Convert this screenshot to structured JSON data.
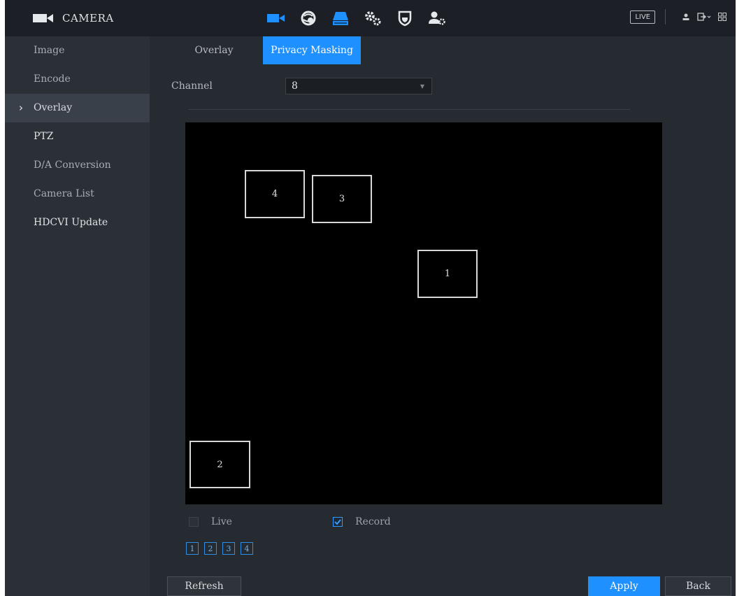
{
  "app": {
    "title": "CAMERA",
    "icon": "camera-icon"
  },
  "nav_icons": [
    {
      "name": "camera-nav-icon",
      "color": "#1e90ff"
    },
    {
      "name": "network-nav-icon",
      "color": "#e6e6e6"
    },
    {
      "name": "storage-nav-icon",
      "color": "#1e90ff"
    },
    {
      "name": "system-settings-nav-icon",
      "color": "#e6e6e6"
    },
    {
      "name": "security-nav-icon",
      "color": "#e6e6e6"
    },
    {
      "name": "account-nav-icon",
      "color": "#e6e6e6"
    }
  ],
  "header_tools": {
    "live_label": "LIVE"
  },
  "sidebar": {
    "items": [
      {
        "label": "Image"
      },
      {
        "label": "Encode"
      },
      {
        "label": "Overlay",
        "active": true
      },
      {
        "label": "PTZ"
      },
      {
        "label": "D/A Conversion"
      },
      {
        "label": "Camera List"
      },
      {
        "label": "HDCVI Update"
      }
    ]
  },
  "tabs": [
    {
      "label": "Overlay"
    },
    {
      "label": "Privacy Masking",
      "selected": true
    }
  ],
  "channel": {
    "label": "Channel",
    "value": "8"
  },
  "masks": [
    {
      "label": "4"
    },
    {
      "label": "3"
    },
    {
      "label": "1"
    },
    {
      "label": "2"
    }
  ],
  "options": {
    "live": {
      "label": "Live",
      "checked": false
    },
    "record": {
      "label": "Record",
      "checked": true
    }
  },
  "region_buttons": [
    "1",
    "2",
    "3",
    "4"
  ],
  "footer": {
    "refresh": "Refresh",
    "apply": "Apply",
    "back": "Back"
  },
  "colors": {
    "accent": "#1e90ff",
    "background": "#2b3037",
    "video": "#000000"
  }
}
